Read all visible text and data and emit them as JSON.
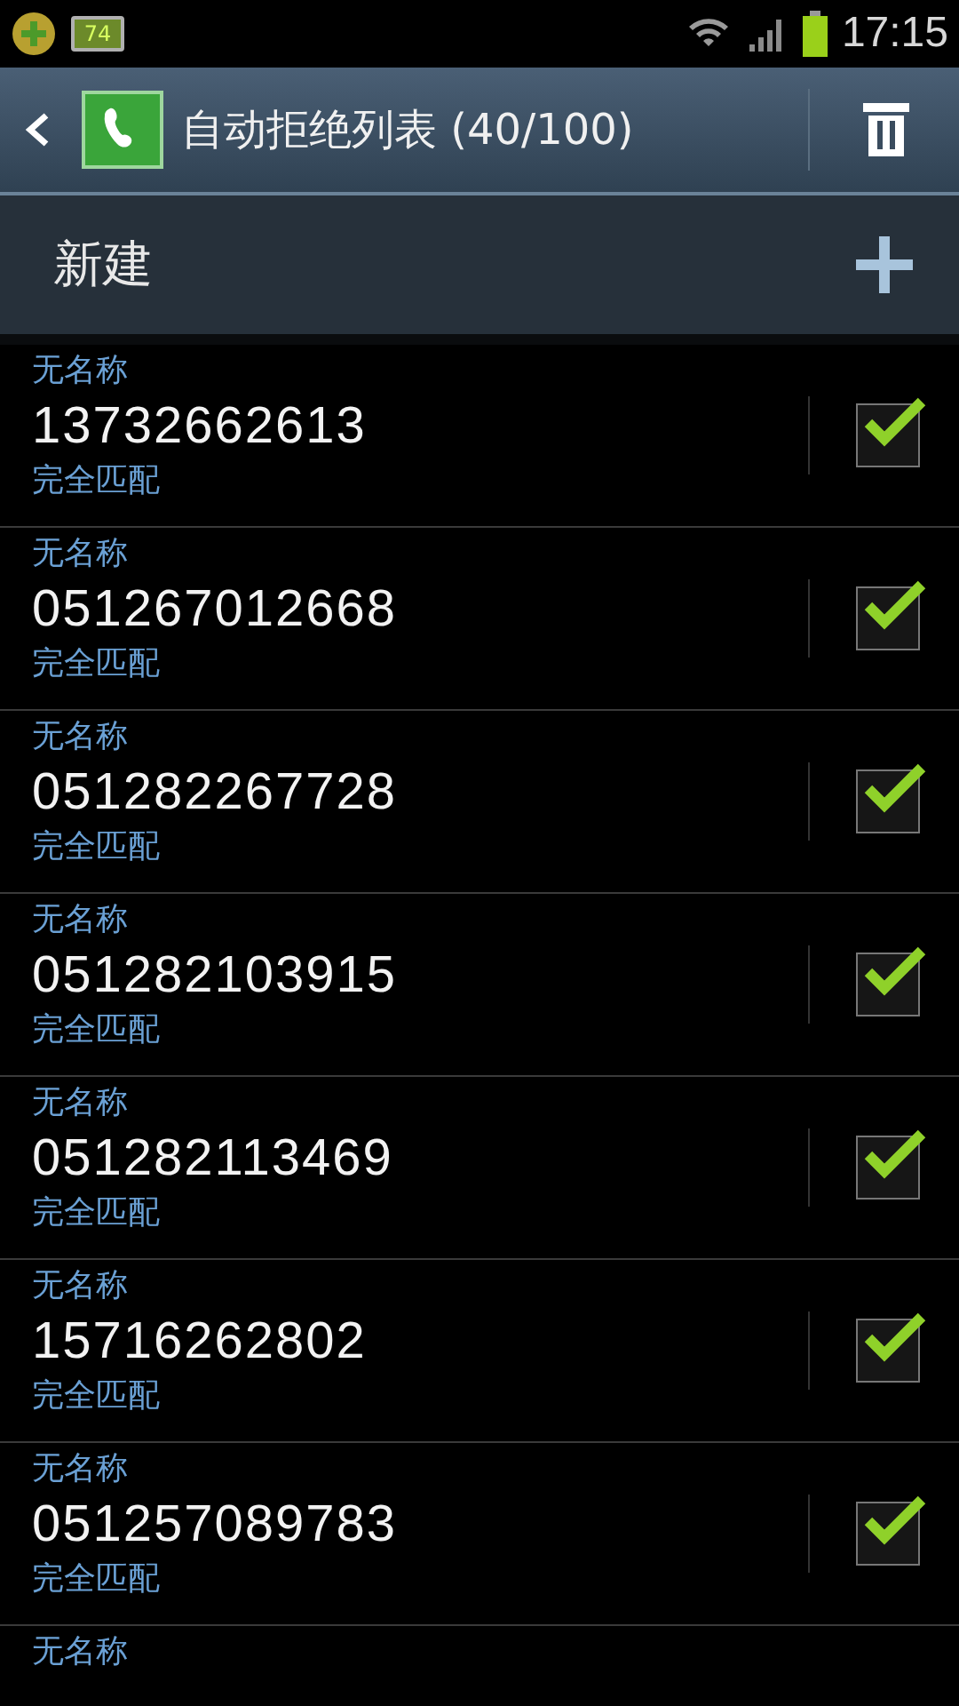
{
  "status_bar": {
    "battery_badge": "74",
    "time": "17:15"
  },
  "action_bar": {
    "title": "自动拒绝列表 (40/100)"
  },
  "new_item": {
    "label": "新建"
  },
  "rows": [
    {
      "name": "无名称",
      "number": "13732662613",
      "match": "完全匹配",
      "checked": true
    },
    {
      "name": "无名称",
      "number": "051267012668",
      "match": "完全匹配",
      "checked": true
    },
    {
      "name": "无名称",
      "number": "051282267728",
      "match": "完全匹配",
      "checked": true
    },
    {
      "name": "无名称",
      "number": "051282103915",
      "match": "完全匹配",
      "checked": true
    },
    {
      "name": "无名称",
      "number": "051282113469",
      "match": "完全匹配",
      "checked": true
    },
    {
      "name": "无名称",
      "number": "15716262802",
      "match": "完全匹配",
      "checked": true
    },
    {
      "name": "无名称",
      "number": "051257089783",
      "match": "完全匹配",
      "checked": true
    },
    {
      "name": "无名称"
    }
  ]
}
